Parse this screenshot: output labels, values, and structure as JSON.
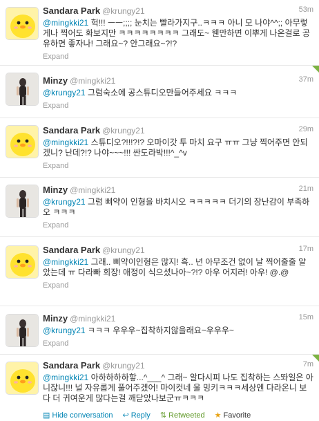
{
  "colors": {
    "mention": "#0084b4",
    "retweeted": "#609928",
    "favorite": "#e8a313",
    "corner": "#7cb342"
  },
  "tweets": [
    {
      "name": "Sandara Park",
      "handle": "@krungy21",
      "time": "53m",
      "mention": "@mingkki21",
      "text": "헉!!! ㅡㅡ;;;; 눈치는 빨라가지구..ㅋㅋㅋ 아니 모 나야^^;; 아무렇게나 찍어도 화보지만 ㅋㅋㅋㅋㅋㅋㅋㅋ 그래도~ 웬만하면 이뿌게 나온걸로 공유하면 좋자나! 그래요~? 안그래요~?!?",
      "expand": "Expand"
    },
    {
      "name": "Minzy",
      "handle": "@mingkki21",
      "time": "37m",
      "mention": "@krungy21",
      "text": "그럼숙소에 공스튜디오만들어주세요 ㅋㅋㅋ",
      "expand": "Expand"
    },
    {
      "name": "Sandara Park",
      "handle": "@krungy21",
      "time": "29m",
      "mention": "@mingkki21",
      "text": "스튜디오?!!!?!? 오마이갓 투 마치 요구 ㅠㅠ 그냥 찍어주면 안되겠니? 난데?!? 나야~~~!!! 싼도라박!!!^_^v",
      "expand": "Expand"
    },
    {
      "name": "Minzy",
      "handle": "@mingkki21",
      "time": "21m",
      "mention": "@krungy21",
      "text": "그럼 삐약이 인형을 바치시오 ㅋㅋㅋㅋㅋ 더기의 장난감이 부족하오 ㅋㅋㅋ",
      "expand": "Expand"
    },
    {
      "name": "Sandara Park",
      "handle": "@krungy21",
      "time": "17m",
      "mention": "@mingkki21",
      "text": "그래.. 삐약이인형은 많지! 흑.. 넌 아무조건 없이 날 찍어줄줄 알았는데 ㅠ 다라빠 회장! 애정이 식으셨나아~?!? 아우 어지러! 아우! @.@",
      "expand": "Expand"
    },
    {
      "name": "Minzy",
      "handle": "@mingkki21",
      "time": "15m",
      "mention": "@krungy21",
      "text": "ㅋㅋㅋ 우우우~집착하지않을래요~우우우~",
      "expand": "Expand"
    },
    {
      "name": "Sandara Park",
      "handle": "@krungy21",
      "time": "7m",
      "mention": "@mingkki21",
      "text": "아하하하하핳...^___^ 그래~ 알다시피 나도 집착하는 스똬일은 아니잖니!!! 널 자유롭게 풀어주겠어! 마이컷네 울 밍키ㅋㅋㅋ세상엔 다라온니 보다 더 귀여운게 많다는걸 깨닫았나보군ㅠㅋㅋㅋ",
      "actions": {
        "hide": "Hide conversation",
        "reply": "Reply",
        "retweeted": "Retweeted",
        "favorite": "Favorite"
      }
    }
  ]
}
